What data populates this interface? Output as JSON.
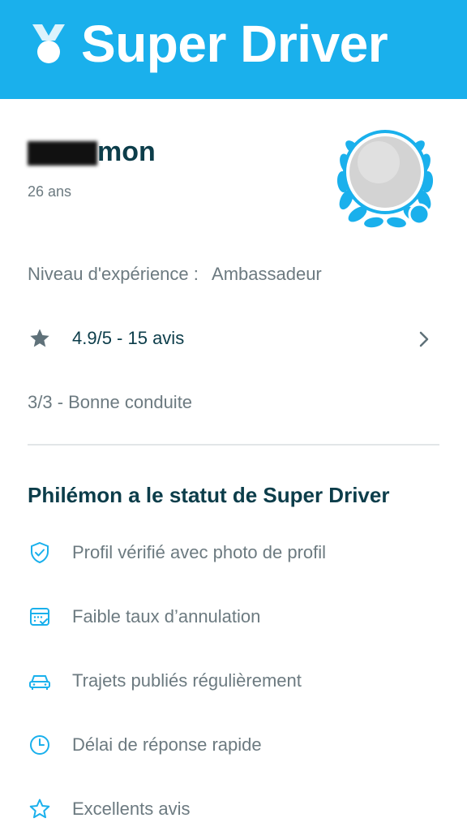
{
  "header": {
    "title": "Super Driver",
    "brand_color": "#1ab0ec"
  },
  "profile": {
    "name_visible": "mon",
    "age": "26 ans",
    "level_label": "Niveau d'expérience :",
    "level_value": "Ambassadeur",
    "rating": "4.9/5 - 15 avis",
    "conduct": "3/3 - Bonne conduite"
  },
  "status": {
    "title": "Philémon a le statut de Super Driver",
    "features": [
      {
        "icon": "shield-check-icon",
        "label": "Profil vérifié avec photo de profil"
      },
      {
        "icon": "calendar-check-icon",
        "label": "Faible taux d’annulation"
      },
      {
        "icon": "car-icon",
        "label": "Trajets publiés régulièrement"
      },
      {
        "icon": "clock-icon",
        "label": "Délai de réponse rapide"
      },
      {
        "icon": "star-outline-icon",
        "label": "Excellents avis"
      }
    ]
  }
}
